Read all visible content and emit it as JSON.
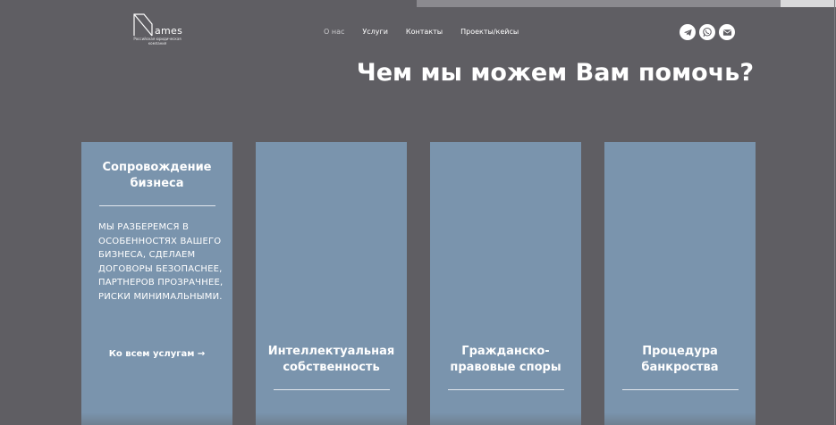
{
  "logo": {
    "word": "ames",
    "subtitle": "Российская юридическая компания"
  },
  "nav": {
    "items": [
      {
        "label": "О нас",
        "active": true
      },
      {
        "label": "Услуги",
        "active": false
      },
      {
        "label": "Контакты",
        "active": false
      },
      {
        "label": "Проекты/кейсы",
        "active": false
      }
    ]
  },
  "social": [
    "telegram-icon",
    "whatsapp-icon",
    "email-icon"
  ],
  "heading": "Чем мы можем Вам помочь?",
  "cards": [
    {
      "title": "Сопровождение бизнеса",
      "description": "Мы разберемся в особенностях вашего бизнеса, сделаем договоры безопаснее, партнеров прозрачнее, риски минимальными.",
      "link": "Ко всем услугам →"
    },
    {
      "title": "Интеллектуальная собственность"
    },
    {
      "title": "Гражданско-правовые споры"
    },
    {
      "title": "Процедура банкроства"
    }
  ],
  "colors": {
    "background": "#5f5e63",
    "card": "#7a94ad",
    "text": "#ffffff"
  }
}
